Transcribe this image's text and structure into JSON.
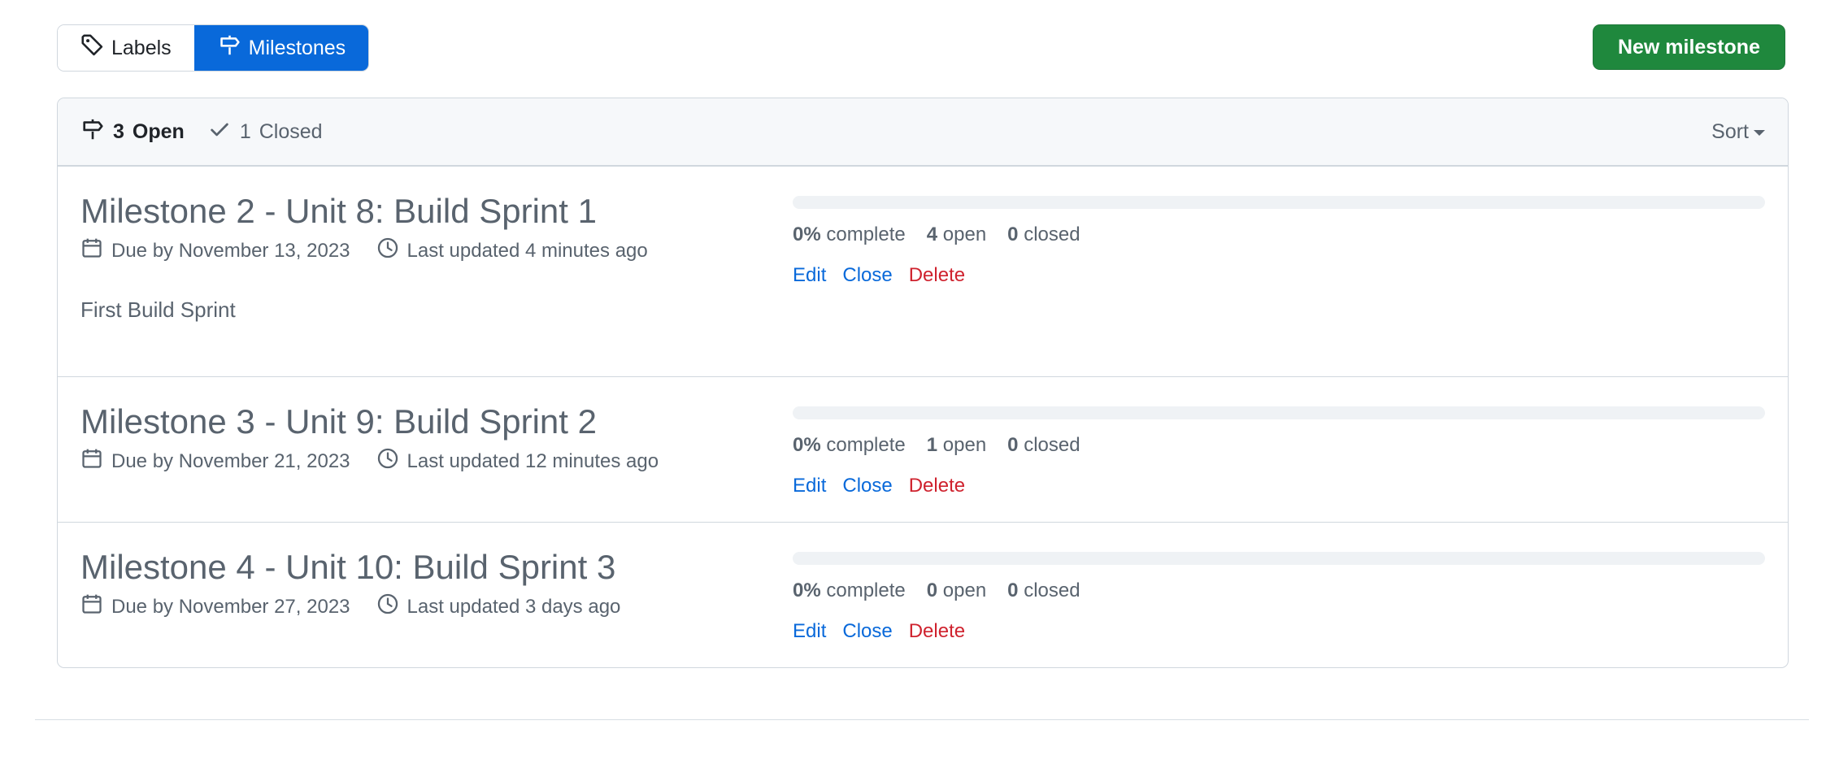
{
  "subnav": {
    "labels": "Labels",
    "milestones": "Milestones"
  },
  "new_milestone_button": "New milestone",
  "filters": {
    "open_count": "3",
    "open_label": "Open",
    "closed_count": "1",
    "closed_label": "Closed",
    "sort": "Sort"
  },
  "milestones": [
    {
      "title": "Milestone 2 - Unit 8: Build Sprint 1",
      "due": "Due by November 13, 2023",
      "updated": "Last updated 4 minutes ago",
      "description": "First Build Sprint",
      "percent": "0%",
      "percent_label": "complete",
      "open": "4",
      "open_label": "open",
      "closed": "0",
      "closed_label": "closed",
      "progress_fraction": 0
    },
    {
      "title": "Milestone 3 - Unit 9: Build Sprint 2",
      "due": "Due by November 21, 2023",
      "updated": "Last updated 12 minutes ago",
      "description": "",
      "percent": "0%",
      "percent_label": "complete",
      "open": "1",
      "open_label": "open",
      "closed": "0",
      "closed_label": "closed",
      "progress_fraction": 0
    },
    {
      "title": "Milestone 4 - Unit 10: Build Sprint 3",
      "due": "Due by November 27, 2023",
      "updated": "Last updated 3 days ago",
      "description": "",
      "percent": "0%",
      "percent_label": "complete",
      "open": "0",
      "open_label": "open",
      "closed": "0",
      "closed_label": "closed",
      "progress_fraction": 0
    }
  ],
  "actions": {
    "edit": "Edit",
    "close": "Close",
    "delete": "Delete"
  },
  "icons": {
    "labels": "tag-icon",
    "milestones": "milestone-icon",
    "closed": "check-icon",
    "due": "calendar-icon",
    "updated": "clock-icon"
  },
  "colors": {
    "accent": "#0969da",
    "primary_button": "#1f883d",
    "danger": "#cf222e"
  }
}
